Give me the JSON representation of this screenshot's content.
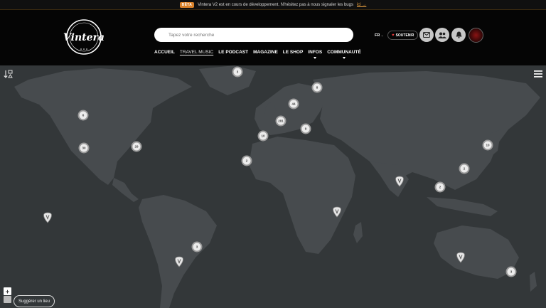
{
  "beta_bar": {
    "badge": "BÊTA",
    "message": "Vintera V2 est en cours de développement. N'hésitez pas à nous signaler les bugs",
    "link": "ici →"
  },
  "header": {
    "logo_text": "Vintera",
    "search": {
      "placeholder": "Tapez votre recherche"
    },
    "nav": [
      {
        "label": "ACCUEIL"
      },
      {
        "label": "TRAVEL MUSIC"
      },
      {
        "label": "LE PODCAST"
      },
      {
        "label": "MAGAZINE"
      },
      {
        "label": "LE SHOP"
      },
      {
        "label": "INFOS"
      },
      {
        "label": "COMMUNAUTÉ"
      }
    ],
    "lang": "FR",
    "soutenir": "SOUTENIR",
    "icons": [
      "mail-icon",
      "users-icon",
      "bell-icon"
    ]
  },
  "map": {
    "clusters": [
      {
        "label": "3"
      },
      {
        "label": "8"
      },
      {
        "label": "44"
      },
      {
        "label": "6"
      },
      {
        "label": "281"
      },
      {
        "label": "9"
      },
      {
        "label": "10"
      },
      {
        "label": "30"
      },
      {
        "label": "29"
      },
      {
        "label": "2"
      },
      {
        "label": "10"
      },
      {
        "label": "2"
      },
      {
        "label": "2"
      },
      {
        "label": "3"
      },
      {
        "label": "3"
      }
    ],
    "suggest_label": "Suggérer un lieu",
    "zoom_in": "+"
  },
  "colors": {
    "accent": "#d9822b",
    "map_bg": "#333739",
    "land": "#474b4e"
  }
}
